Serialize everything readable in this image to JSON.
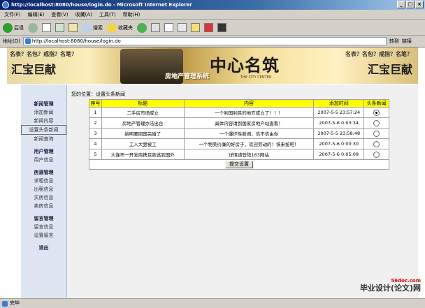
{
  "window": {
    "title": "http://localhost:8080/house/login.do - Microsoft Internet Explorer",
    "buttons": [
      "_",
      "□",
      "×"
    ]
  },
  "menu": [
    "文件(F)",
    "编辑(E)",
    "查看(V)",
    "收藏(A)",
    "工具(T)",
    "帮助(H)"
  ],
  "toolbar": {
    "back": "后退",
    "search": "搜索",
    "favorites": "收藏夹"
  },
  "address": {
    "label": "地址(D)",
    "url": "http://localhost:8080/house/login.do",
    "go": "转到",
    "links": "链接"
  },
  "banner": {
    "left_top": "名表？名包？戒指？名笔？",
    "left_main": "汇宝巨献",
    "logo": "中心名筑",
    "system": "房地产管理系统",
    "city": "THE CITY CENTER",
    "right_top": "名表？名包？戒指？名笔？",
    "right_main": "汇宝巨献"
  },
  "sidebar": {
    "groups": [
      {
        "head": "新闻管理",
        "items": [
          "添加新闻",
          "新闻内容",
          "设置头条新闻",
          "新闻查询"
        ]
      },
      {
        "head": "用户管理",
        "items": [
          "用户信息"
        ]
      },
      {
        "head": "房源管理",
        "items": [
          "求租信息",
          "出租信息",
          "买房信息",
          "卖房信息"
        ]
      },
      {
        "head": "留言管理",
        "items": [
          "留言信息",
          "设置留言"
        ]
      },
      {
        "head": "退出",
        "items": []
      }
    ],
    "active": "设置头条新闻"
  },
  "main": {
    "location": "您的位置：设置头条新闻",
    "columns": [
      "序号",
      "标题",
      "内容",
      "添加时间",
      "头条新闻"
    ],
    "rows": [
      {
        "no": "1",
        "title": "二手房市场成立",
        "content": "一个利国利民的地方成立了！！！",
        "time": "2007-5-5 23:57:24",
        "checked": true
      },
      {
        "no": "2",
        "title": "房地产管理办法出台",
        "content": "具体内容请到国家房地产站查看！",
        "time": "2007-5-6 0:03:34",
        "checked": false
      },
      {
        "no": "3",
        "title": "姚明要回国完婚了",
        "content": "一个爆炸性新闻，信不信由你",
        "time": "2007-5-5 23:58:48",
        "checked": false
      },
      {
        "no": "4",
        "title": "工人大罢被工",
        "content": "一个物美价廉的好房子，欢迎劳动的！快来抢吧！",
        "time": "2007-5-6 0:00:30",
        "checked": false
      },
      {
        "no": "5",
        "title": "大连市一开发商携巨款逃到国外",
        "content": "详情请登陆163网站",
        "time": "2007-5-6 0:05:09",
        "checked": false
      }
    ],
    "submit": "提交设置"
  },
  "status": {
    "text": "完毕",
    "brand_url": "56doc.com",
    "brand": "毕业设计(论文)网"
  }
}
